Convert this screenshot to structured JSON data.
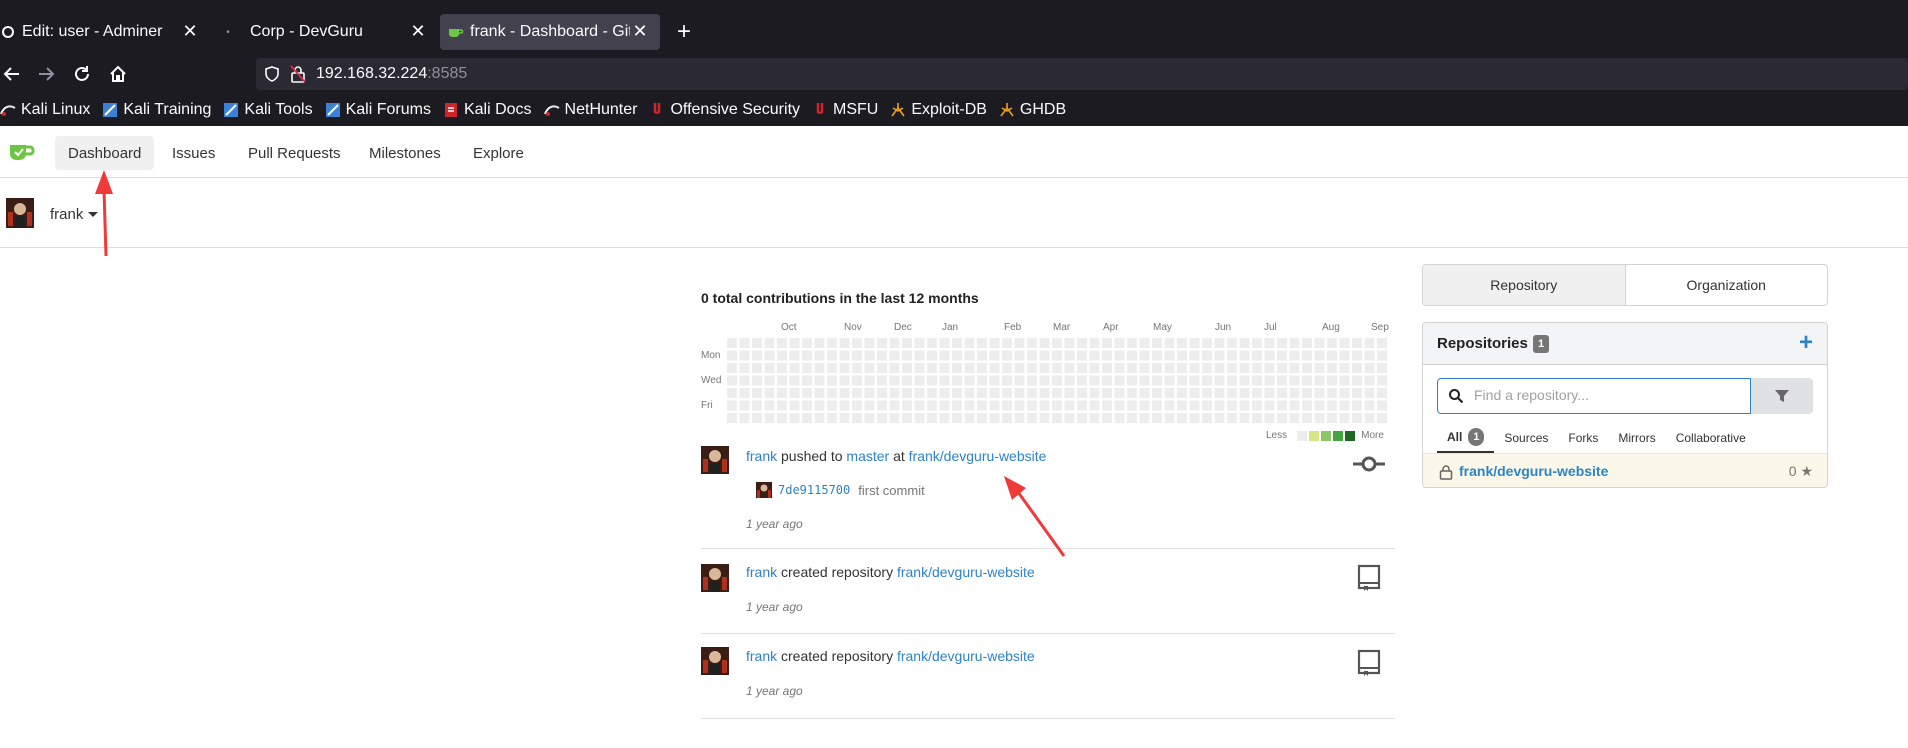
{
  "browser": {
    "tabs": [
      {
        "label": "Edit: user - Adminer",
        "active": false
      },
      {
        "label": "Corp - DevGuru",
        "active": false
      },
      {
        "label": "frank - Dashboard - Gitea",
        "active": true
      }
    ],
    "new_tab": "+",
    "url": {
      "host": "192.168.32.224",
      "port": ":8585"
    },
    "bookmarks": [
      "Kali Linux",
      "Kali Training",
      "Kali Tools",
      "Kali Forums",
      "Kali Docs",
      "NetHunter",
      "Offensive Security",
      "MSFU",
      "Exploit-DB",
      "GHDB"
    ]
  },
  "gitea": {
    "menu": [
      "Dashboard",
      "Issues",
      "Pull Requests",
      "Milestones",
      "Explore"
    ],
    "context_user": "frank",
    "heatmap": {
      "title": "0 total contributions in the last 12 months",
      "months": [
        "Oct",
        "Nov",
        "Dec",
        "Jan",
        "Feb",
        "Mar",
        "Apr",
        "May",
        "Jun",
        "Jul",
        "Aug",
        "Sep"
      ],
      "days": [
        "Mon",
        "Wed",
        "Fri"
      ],
      "legend_less": "Less",
      "legend_more": "More",
      "empty_color": "#ededed",
      "scale_colors": [
        "#ededed",
        "#d6e685",
        "#8cc665",
        "#44a340",
        "#1e6823"
      ]
    },
    "feed": [
      {
        "user": "frank",
        "verb1": "pushed to",
        "branch": "master",
        "verb2": "at",
        "repo": "frank/devguru-website",
        "commit_sha": "7de9115700",
        "commit_msg": "first commit",
        "time": "1 year ago",
        "icon": "git-commit-icon"
      },
      {
        "user": "frank",
        "verb1": "created repository",
        "repo": "frank/devguru-website",
        "time": "1 year ago",
        "icon": "repo-book-icon"
      },
      {
        "user": "frank",
        "verb1": "created repository",
        "repo": "frank/devguru-website",
        "time": "1 year ago",
        "icon": "repo-book-icon"
      }
    ],
    "right": {
      "segments": [
        "Repository",
        "Organization"
      ],
      "repo_title": "Repositories",
      "repo_count": "1",
      "search_placeholder": "Find a repository...",
      "tabs": [
        "All",
        "Sources",
        "Forks",
        "Mirrors",
        "Collaborative"
      ],
      "all_count": "1",
      "repo_name": "frank/devguru-website",
      "repo_stars": "0"
    },
    "accent": "#2d83c5",
    "annotation_color": "#f03a3a"
  }
}
